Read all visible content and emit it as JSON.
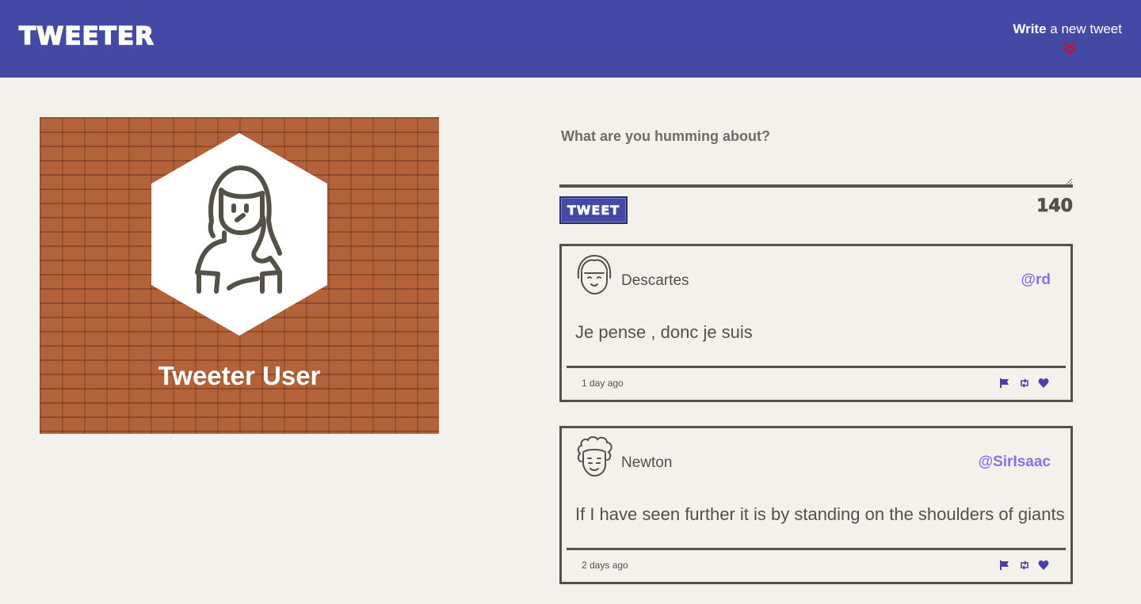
{
  "nav": {
    "brand": "TWEETER",
    "write_bold": "Write",
    "write_rest": " a new tweet",
    "accent_color": "#4349a4",
    "chevron_color": "#c41230"
  },
  "profile": {
    "name": "Tweeter User",
    "avatar_icon": "person-icon"
  },
  "compose": {
    "label": "What are you humming about?",
    "placeholder": "",
    "button_label": "TWEET",
    "char_count": "140"
  },
  "tweets": [
    {
      "name": "Descartes",
      "handle": "@rd",
      "content": "Je pense , donc je suis",
      "time": "1 day ago",
      "avatar_icon": "descartes-avatar-icon"
    },
    {
      "name": "Newton",
      "handle": "@SirIsaac",
      "content": "If I have seen further it is by standing on the shoulders of giants",
      "time": "2 days ago",
      "avatar_icon": "newton-avatar-icon"
    }
  ],
  "colors": {
    "background": "#f4f1ec",
    "text": "#545149",
    "handle": "#8b6ee8",
    "action_icons": "#4a3ea8"
  }
}
